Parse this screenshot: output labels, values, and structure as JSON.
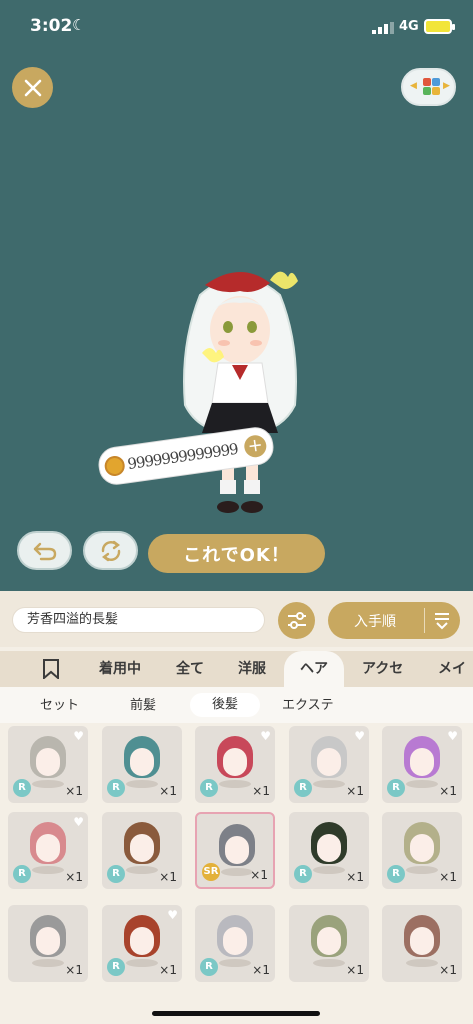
{
  "status": {
    "time": "3:02",
    "network": "4G"
  },
  "stage": {
    "coins": "9999999999999",
    "ok_label": "これでOK！"
  },
  "search": {
    "current_name": "芳香四溢的長髪",
    "sort_label": "入手順"
  },
  "tabs": [
    {
      "label": "着用中"
    },
    {
      "label": "全て"
    },
    {
      "label": "洋服"
    },
    {
      "label": "ヘア"
    },
    {
      "label": "アクセ"
    },
    {
      "label": "メイ"
    }
  ],
  "subtabs": [
    {
      "label": "セット"
    },
    {
      "label": "前髪"
    },
    {
      "label": "後髪"
    },
    {
      "label": "エクステ"
    }
  ],
  "items": [
    {
      "rarity": "R",
      "qty": "×1",
      "hair": "#b9b6ae",
      "bear": true
    },
    {
      "rarity": "R",
      "qty": "×1",
      "hair": "#4f8f92",
      "bear": false
    },
    {
      "rarity": "R",
      "qty": "×1",
      "hair": "#c8485a",
      "bear": true
    },
    {
      "rarity": "R",
      "qty": "×1",
      "hair": "#c8c8c8",
      "bear": true
    },
    {
      "rarity": "R",
      "qty": "×1",
      "hair": "#b87ad2",
      "bear": true
    },
    {
      "rarity": "R",
      "qty": "×1",
      "hair": "#d88a8e",
      "bear": true
    },
    {
      "rarity": "R",
      "qty": "×1",
      "hair": "#8a5a3c",
      "bear": false
    },
    {
      "rarity": "SR",
      "qty": "×1",
      "hair": "#7d8088",
      "bear": false
    },
    {
      "rarity": "R",
      "qty": "×1",
      "hair": "#2f3b2a",
      "bear": false
    },
    {
      "rarity": "R",
      "qty": "×1",
      "hair": "#b3b08a",
      "bear": false
    },
    {
      "rarity": "",
      "qty": "×1",
      "hair": "#9a9a9a",
      "bear": false
    },
    {
      "rarity": "R",
      "qty": "×1",
      "hair": "#a8432c",
      "bear": true
    },
    {
      "rarity": "R",
      "qty": "×1",
      "hair": "#b9b9bf",
      "bear": false
    },
    {
      "rarity": "",
      "qty": "×1",
      "hair": "#9aa27c",
      "bear": false
    },
    {
      "rarity": "",
      "qty": "×1",
      "hair": "#9c6f62",
      "bear": false
    }
  ]
}
